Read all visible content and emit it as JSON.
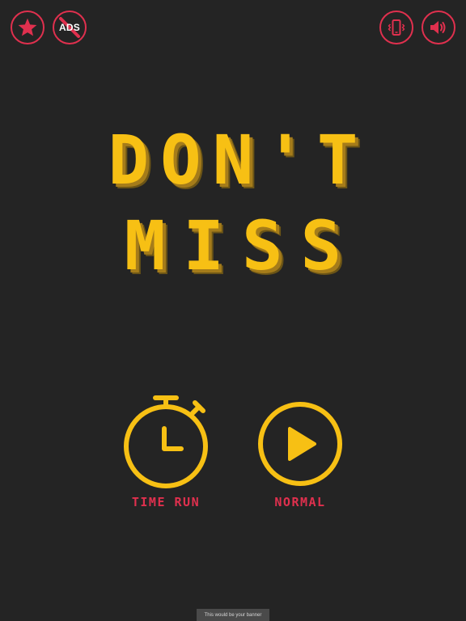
{
  "top_bar": {
    "star_icon": "star-icon",
    "no_ads_label": "ADS",
    "vibration_icon": "vibration-icon",
    "sound_icon": "speaker-icon"
  },
  "title": {
    "line1": "DON'T",
    "line2": "MISS"
  },
  "modes": [
    {
      "label": "TIME RUN",
      "icon": "stopwatch-icon"
    },
    {
      "label": "NORMAL",
      "icon": "play-icon"
    }
  ],
  "banner": {
    "text": "This would be your banner"
  },
  "colors": {
    "background": "#242424",
    "accent_red": "#e0304e",
    "title_yellow": "#f7c014",
    "title_shadow": "#a57c1a",
    "banner_bg": "#4a4a4a"
  }
}
